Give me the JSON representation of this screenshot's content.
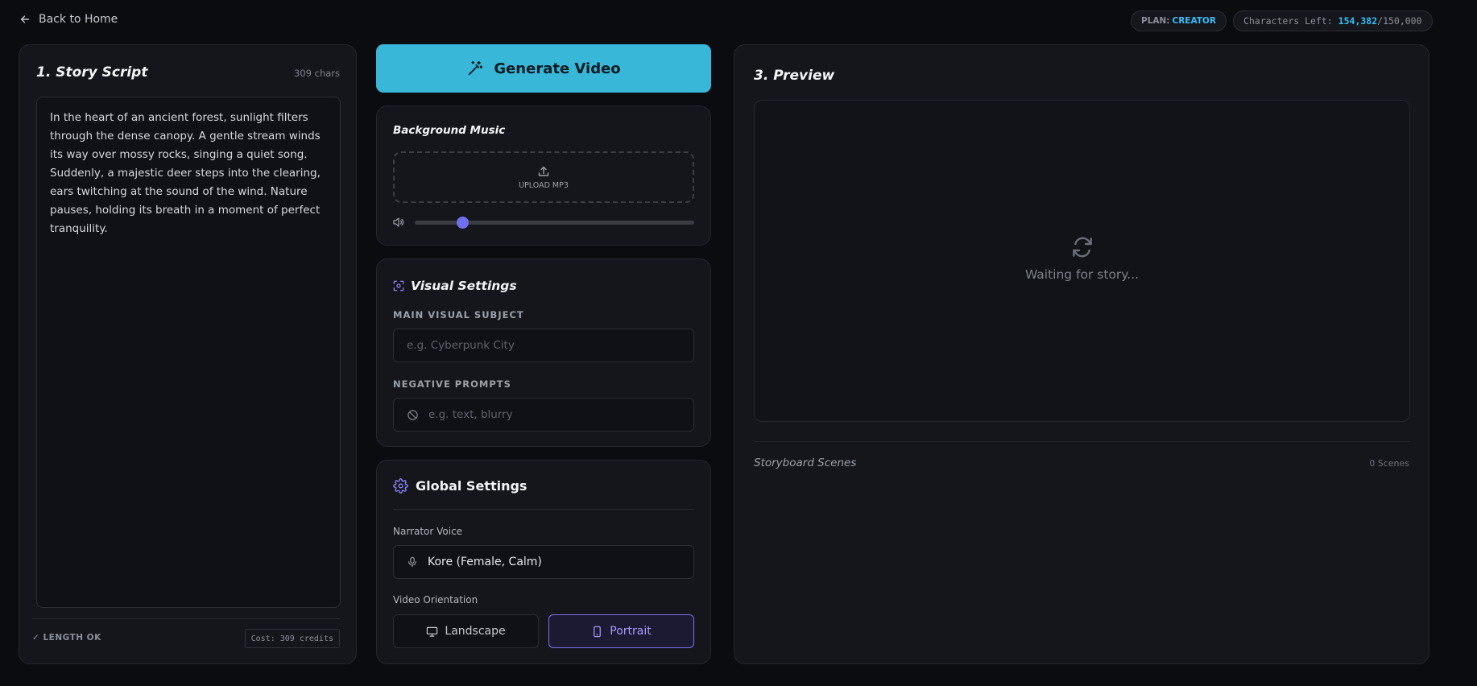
{
  "nav": {
    "back_label": "Back to Home"
  },
  "plan": {
    "label": "PLAN:",
    "value": "CREATOR"
  },
  "characters": {
    "label": "Characters Left:",
    "value": "154,382",
    "total": "/150,000"
  },
  "script_panel": {
    "title": "1. Story Script",
    "char_count": "309 chars",
    "text": "In the heart of an ancient forest, sunlight filters through the dense canopy. A gentle stream winds its way over mossy rocks, singing a quiet song. Suddenly, a majestic deer steps into the clearing, ears twitching at the sound of the wind. Nature pauses, holding its breath in a moment of perfect tranquility.",
    "length_status": "✓ LENGTH OK",
    "cost": "Cost: 309 credits"
  },
  "generate": {
    "label": "Generate Video"
  },
  "music": {
    "title": "Background Music",
    "upload_label": "UPLOAD MP3",
    "volume": 0.17
  },
  "visual": {
    "title": "Visual Settings",
    "subject_label": "MAIN VISUAL SUBJECT",
    "subject_placeholder": "e.g. Cyberpunk City",
    "negative_label": "NEGATIVE PROMPTS",
    "negative_placeholder": "e.g. text, blurry"
  },
  "global": {
    "title": "Global Settings",
    "voice_label": "Narrator Voice",
    "voice_value": "Kore (Female, Calm)",
    "orientation_label": "Video Orientation",
    "landscape_label": "Landscape",
    "portrait_label": "Portrait",
    "selected_orientation": "Portrait"
  },
  "preview": {
    "title": "3. Preview",
    "waiting_text": "Waiting for story...",
    "storyboard_label": "Storyboard Scenes",
    "scene_count": "0 Scenes"
  },
  "colors": {
    "accent": "#38b7d8",
    "purple": "#7b72e8",
    "background": "#0b0c10",
    "panel": "#14161c"
  }
}
